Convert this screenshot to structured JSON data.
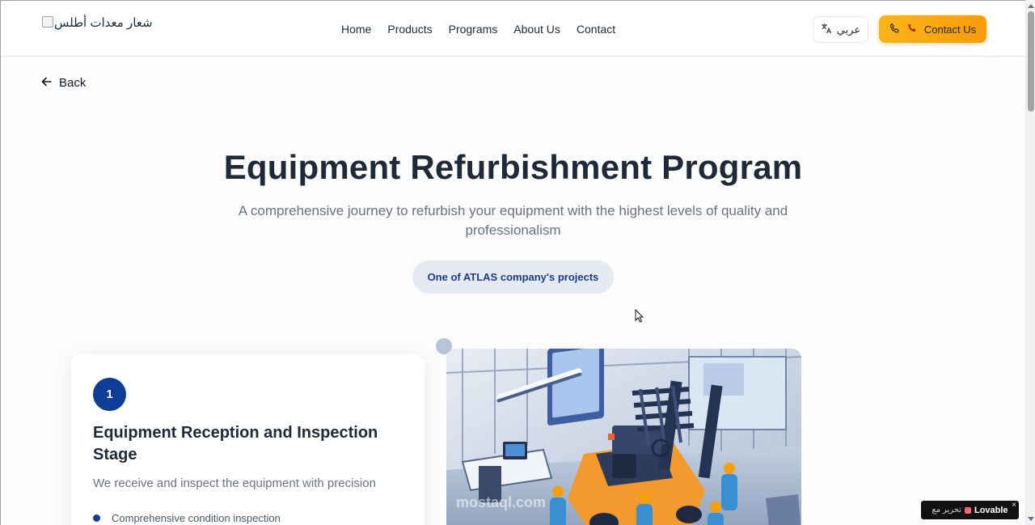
{
  "header": {
    "logo_alt": "شعار معدات أطلس",
    "nav": [
      "Home",
      "Products",
      "Programs",
      "About Us",
      "Contact"
    ],
    "language_label": "عربي",
    "contact_label": "Contact Us"
  },
  "back_label": "Back",
  "hero": {
    "title": "Equipment Refurbishment Program",
    "subtitle": "A comprehensive journey to refurbish your equipment with the highest levels of quality and professionalism",
    "badge": "One of ATLAS company's projects"
  },
  "step": {
    "number": "1",
    "title": "Equipment Reception and Inspection Stage",
    "description": "We receive and inspect the equipment with precision",
    "items": [
      "Comprehensive condition inspection"
    ]
  },
  "illustration": {
    "watermark": "mostaql.com"
  },
  "lovable_badge": {
    "prefix": "تحرير مع",
    "brand": "Lovable",
    "close": "×"
  },
  "colors": {
    "primary": "#0d3d96",
    "accent": "#fbb417",
    "pill_bg": "#e5eaf3"
  }
}
